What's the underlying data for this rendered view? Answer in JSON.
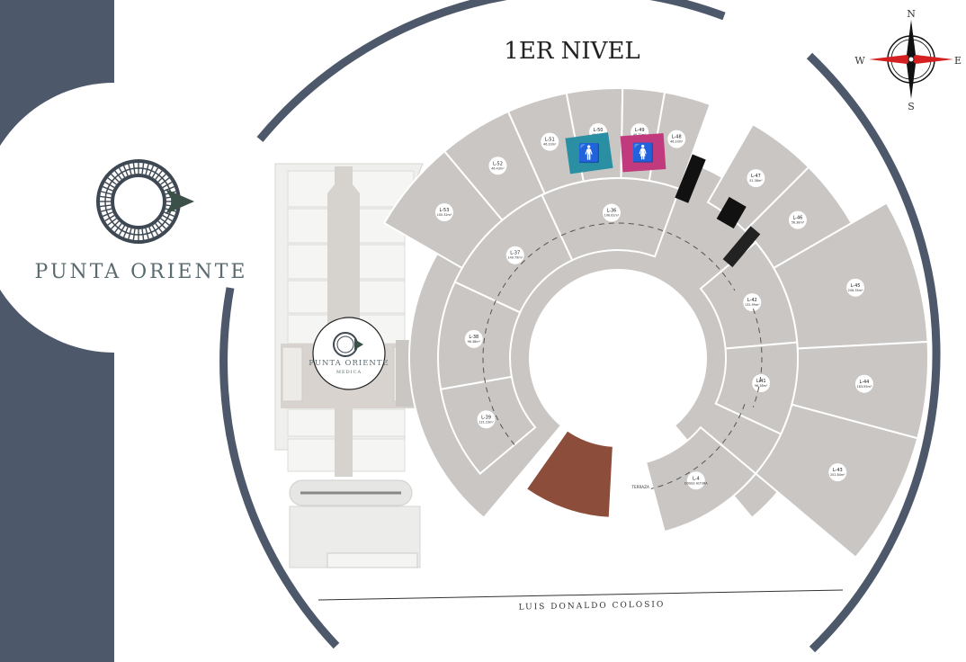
{
  "title": "1ER NIVEL",
  "brand": {
    "name": "PUNTA ORIENTE",
    "medical_name": "PUNTA ORIENTE",
    "medical_sub": "MEDICA"
  },
  "compass": {
    "n": "N",
    "s": "S",
    "e": "E",
    "w": "W"
  },
  "street": "LUIS DONALDO COLOSIO",
  "terrace_label": "TERRAZA",
  "colors": {
    "sidebar": "#4d596b",
    "ring": "#4d596b",
    "unit": "#c9c6c3",
    "unit_edge": "#ffffff",
    "mens_room": "#2a8fa3",
    "womens_room": "#c23a7e",
    "terrace": "#8c4d3b",
    "compass_red": "#d42020"
  },
  "units": [
    {
      "id": "L-53",
      "area": "100.32m²"
    },
    {
      "id": "L-52",
      "area": "46.43m²"
    },
    {
      "id": "L-51",
      "area": "46.33m²"
    },
    {
      "id": "L-50",
      "area": "46.33m²"
    },
    {
      "id": "L-49",
      "area": "46.32m²"
    },
    {
      "id": "L-48",
      "area": "46.33m²"
    },
    {
      "id": "L-47",
      "area": "51.38m²"
    },
    {
      "id": "L-46",
      "area": "56.38m²"
    },
    {
      "id": "L-45",
      "area": "206.35m²"
    },
    {
      "id": "L-44",
      "area": "183.95m²"
    },
    {
      "id": "L-43",
      "area": "202.84m²"
    },
    {
      "id": "L-42",
      "area": "132.99m²"
    },
    {
      "id": "L-41",
      "area": "96.38m²"
    },
    {
      "id": "L-4",
      "area": "DOBLE ALTURA"
    },
    {
      "id": "L-39",
      "area": "131.23m²"
    },
    {
      "id": "L-38",
      "area": "96.38m²"
    },
    {
      "id": "L-37",
      "area": "140.79m²"
    },
    {
      "id": "L-36",
      "area": "106.61m²"
    }
  ]
}
